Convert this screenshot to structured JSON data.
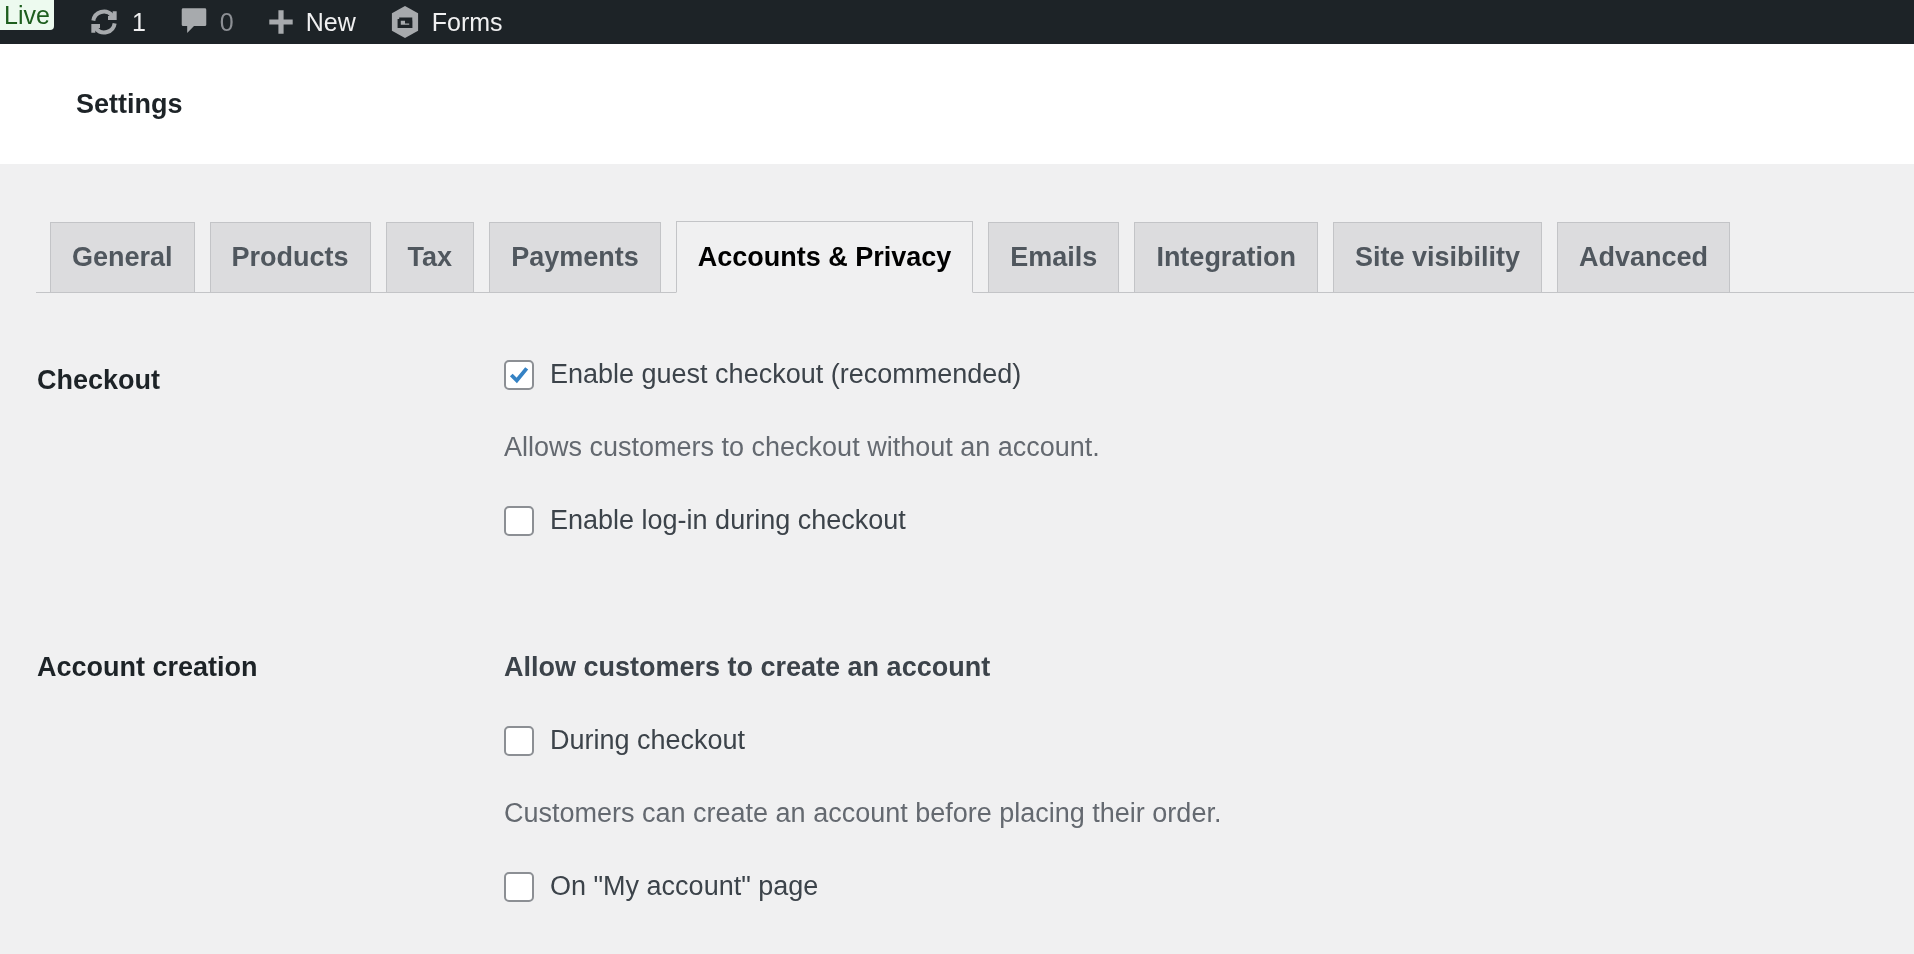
{
  "admin_bar": {
    "live_badge": "Live",
    "updates": "1",
    "comments": "0",
    "new": "New",
    "forms": "Forms"
  },
  "page_title": "Settings",
  "tabs": [
    {
      "label": "General",
      "selected": false
    },
    {
      "label": "Products",
      "selected": false
    },
    {
      "label": "Tax",
      "selected": false
    },
    {
      "label": "Payments",
      "selected": false
    },
    {
      "label": "Accounts & Privacy",
      "selected": true
    },
    {
      "label": "Emails",
      "selected": false
    },
    {
      "label": "Integration",
      "selected": false
    },
    {
      "label": "Site visibility",
      "selected": false
    },
    {
      "label": "Advanced",
      "selected": false
    }
  ],
  "sections": [
    {
      "label": "Checkout",
      "items": [
        {
          "kind": "checkbox",
          "label": "Enable guest checkout (recommended)",
          "checked": true
        },
        {
          "kind": "description",
          "text": "Allows customers to checkout without an account."
        },
        {
          "kind": "checkbox",
          "label": "Enable log-in during checkout",
          "checked": false
        }
      ]
    },
    {
      "label": "Account creation",
      "items": [
        {
          "kind": "heading",
          "text": "Allow customers to create an account"
        },
        {
          "kind": "checkbox",
          "label": "During checkout",
          "checked": false
        },
        {
          "kind": "description",
          "text": "Customers can create an account before placing their order."
        },
        {
          "kind": "checkbox",
          "label": "On \"My account\" page",
          "checked": false
        }
      ]
    }
  ]
}
